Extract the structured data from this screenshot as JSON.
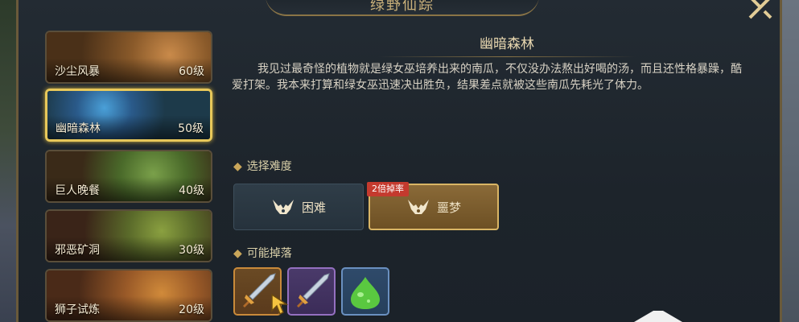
{
  "header": {
    "title": "绿野仙踪"
  },
  "levels": [
    {
      "name": "沙尘风暴",
      "level": "60级"
    },
    {
      "name": "幽暗森林",
      "level": "50级",
      "selected": true
    },
    {
      "name": "巨人晚餐",
      "level": "40级"
    },
    {
      "name": "邪恶矿洞",
      "level": "30级"
    },
    {
      "name": "狮子试炼",
      "level": "20级"
    }
  ],
  "detail": {
    "title": "幽暗森林",
    "description": "我见过最奇怪的植物就是绿女巫培养出来的南瓜，不仅没办法熬出好喝的汤，而且还性格暴躁，酷爱打架。我本来打算和绿女巫迅速决出胜负，结果差点就被这些南瓜先耗光了体力。"
  },
  "difficulty": {
    "label": "选择难度",
    "options": [
      {
        "label": "困难"
      },
      {
        "label": "噩梦",
        "badge": "2倍掉率",
        "selected": true
      }
    ]
  },
  "drops": {
    "label": "可能掉落",
    "items": [
      {
        "icon": "sword-icon",
        "rarity_color": "#c98a3a"
      },
      {
        "icon": "sword-icon",
        "rarity_color": "#9470c0"
      },
      {
        "icon": "green-slime-icon",
        "rarity_color": "#6a90c0"
      }
    ]
  },
  "icons": {
    "close": "close-icon",
    "difficulty": "horned-helmet-icon",
    "cursor": "cursor-arrow-icon"
  },
  "colors": {
    "accent_gold": "#e8c85a",
    "badge_red": "#c43a2e"
  }
}
